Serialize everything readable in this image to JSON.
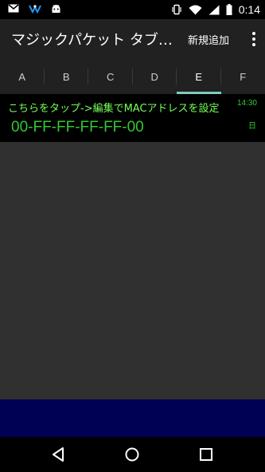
{
  "status_bar": {
    "left_icons": [
      "gmail-icon",
      "vpn-key-icon",
      "android-icon"
    ],
    "right_icons": [
      "vibrate-icon",
      "wifi-icon",
      "signal-icon",
      "battery-icon"
    ],
    "time": "0:14"
  },
  "app_bar": {
    "title": "マジックパケット タブ…",
    "add_new_label": "新規追加",
    "overflow_icon": "more-vert-icon"
  },
  "tabs": [
    {
      "label": "A",
      "active": false
    },
    {
      "label": "B",
      "active": false
    },
    {
      "label": "C",
      "active": false
    },
    {
      "label": "D",
      "active": false
    },
    {
      "label": "E",
      "active": true
    },
    {
      "label": "F",
      "active": false
    }
  ],
  "entries": [
    {
      "label": "こちらをタップ->編集でMACアドレスを設定",
      "mac": "00-FF-FF-FF-FF-00",
      "time": "14:30",
      "day": "日"
    }
  ],
  "nav_bar": {
    "icons": [
      "back-icon",
      "home-icon",
      "recents-icon"
    ]
  },
  "colors": {
    "accent": "#80cbc4",
    "label_green": "#76ff57",
    "mac_green": "#32c832",
    "bottom_panel": "#000055"
  }
}
